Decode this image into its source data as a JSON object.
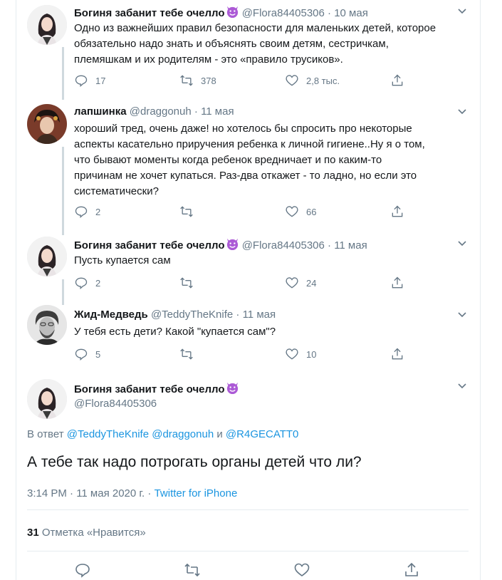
{
  "colors": {
    "accent": "#1da1f2",
    "link": "#1b95e0",
    "muted": "#657786",
    "devil": "#ac5ad6"
  },
  "tweets": [
    {
      "name": "Богиня забанит тебе очелло",
      "emoji": "smiling-devil-emoji",
      "handle": "@Flora84405306",
      "date": "10 мая",
      "lines": [
        "Одно из важнейших правил безопасности для маленьких детей, которое",
        "обязательно надо знать и объяснять своим детям, сестричкам,",
        "племяшкам и их родителям - это «правило трусиков»."
      ],
      "replies": "17",
      "retweets": "378",
      "likes": "2,8 тыс."
    },
    {
      "name": "лапшинка",
      "handle": "@draggonuh",
      "date": "11 мая",
      "lines": [
        "хороший тред, очень даже! но хотелось бы спросить про некоторые",
        "аспекты касательно приручения ребенка к личной гигиене..Ну я о том,",
        "что бывают моменты когда ребенок вредничает и по каким-то",
        "причинам не хочет купаться. Раз-два откажет - то ладно, но если это",
        "систематически?"
      ],
      "replies": "2",
      "retweets": "",
      "likes": "66"
    },
    {
      "name": "Богиня забанит тебе очелло",
      "handle": "@Flora84405306",
      "date": "11 мая",
      "lines": [
        "Пусть купается сам"
      ],
      "replies": "2",
      "retweets": "",
      "likes": "24"
    },
    {
      "name": "Жид-Медведь",
      "handle": "@TeddyTheKnife",
      "date": "11 мая",
      "lines": [
        "У тебя есть дети? Какой \"купается сам\"?"
      ],
      "replies": "5",
      "retweets": "",
      "likes": "10"
    }
  ],
  "dot": "·",
  "main": {
    "name": "Богиня забанит тебе очелло",
    "handle": "@Flora84405306",
    "reply_prefix": "В ответ",
    "reply_to_1": "@TeddyTheKnife",
    "reply_to_2": "@draggonuh",
    "reply_and": "и",
    "reply_to_3": "@R4GECATT0",
    "text": "А тебе так надо потрогать органы детей что ли?",
    "time": "3:14 PM · 11 мая 2020 г.",
    "source_sep": "·",
    "source": "Twitter for iPhone",
    "likes_count": "31",
    "likes_label": "Отметка «Нравится»"
  }
}
